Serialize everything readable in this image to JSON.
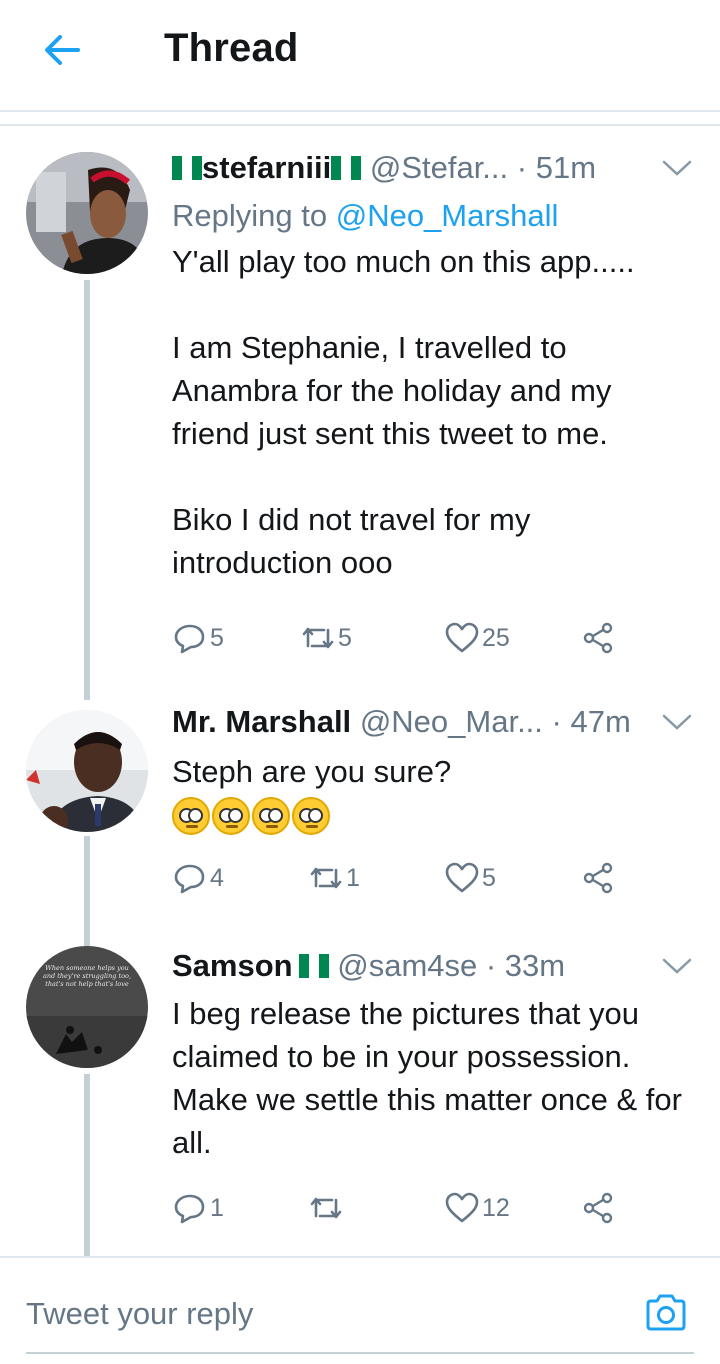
{
  "header": {
    "title": "Thread",
    "back_icon": "arrow-left-icon",
    "accent": "#1da1f2"
  },
  "tweets": [
    {
      "name": "stefarniii",
      "name_flags": [
        "nigeria-flag",
        "nigeria-flag"
      ],
      "handle": "@Stefar...",
      "time": "· 51m",
      "replying_prefix": "Replying to ",
      "replying_to": "@Neo_Marshall",
      "text": "Y'all play too much on this app.....\n\nI am Stephanie, I travelled to Anambra for the holiday and my friend just sent this tweet to me.\n\nBiko I did not travel for my introduction ooo",
      "replies": "5",
      "retweets": "5",
      "likes": "25"
    },
    {
      "name": "Mr. Marshall",
      "handle": "@Neo_Mar...",
      "time": "· 47m",
      "text": "Steph are you sure?",
      "emojis": [
        "face-with-rolling-eyes",
        "face-with-rolling-eyes",
        "face-with-rolling-eyes",
        "face-with-rolling-eyes"
      ],
      "replies": "4",
      "retweets": "1",
      "likes": "5"
    },
    {
      "name": "Samson",
      "name_flags": [
        "nigeria-flag"
      ],
      "handle": "@sam4se",
      "time": "· 33m",
      "text": "I beg release the pictures that you claimed to be in your possession. Make we settle this matter once & for all.",
      "avatar_text": "When someone helps you and they're struggling too, that's not help that's love",
      "replies": "1",
      "retweets": "",
      "likes": "12"
    }
  ],
  "reply_bar": {
    "placeholder": "Tweet your reply",
    "camera_icon": "camera-icon"
  },
  "colors": {
    "flag_green": "#008751",
    "flag_white": "#ffffff",
    "text_secondary": "#657786",
    "border": "#e1e8ed"
  }
}
